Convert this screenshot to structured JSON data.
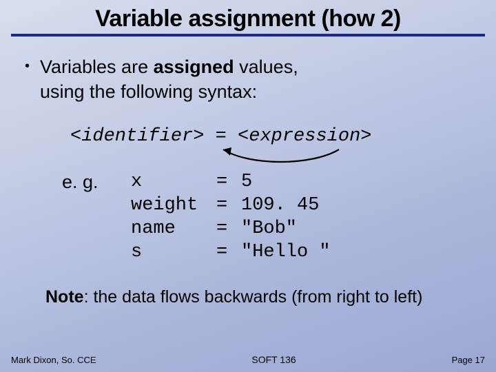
{
  "title": "Variable assignment (how 2)",
  "bullet": {
    "line1_pre": "Variables are ",
    "line1_bold": "assigned",
    "line1_post": " values,",
    "line2": "using the following syntax:"
  },
  "syntax": {
    "ident": "<identifier>",
    "eq": " = ",
    "expr": "<expression>"
  },
  "eg_label": "e. g.",
  "examples": [
    {
      "ident": "x",
      "eq": "=",
      "expr": "5"
    },
    {
      "ident": "weight",
      "eq": "=",
      "expr": "109. 45"
    },
    {
      "ident": "name",
      "eq": "=",
      "expr": "\"Bob\""
    },
    {
      "ident": "s",
      "eq": "=",
      "expr": "\"Hello \""
    }
  ],
  "note": {
    "bold": "Note",
    "rest": ": the data flows backwards (from right to left)"
  },
  "footer": {
    "left": "Mark Dixon, So. CCE",
    "center": "SOFT 136",
    "right": "Page 17"
  }
}
